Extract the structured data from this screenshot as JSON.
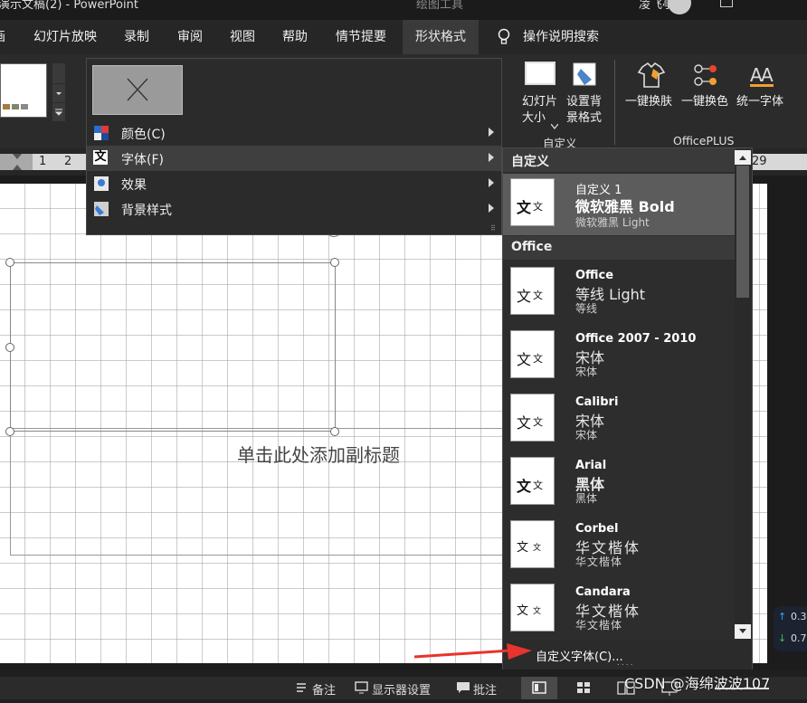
{
  "title_bar": {
    "document_title": "演示文稿(2)  -  PowerPoint",
    "tools_title": "绘图工具",
    "user_name": "凌飞亭"
  },
  "ribbon_tabs": [
    "画",
    "幻灯片放映",
    "录制",
    "审阅",
    "视图",
    "帮助",
    "情节提要",
    "形状格式"
  ],
  "tell_me": "操作说明搜索",
  "ribbon": {
    "slide_size_label_1": "幻灯片",
    "slide_size_label_2": "大小",
    "format_bg_label_1": "设置背",
    "format_bg_label_2": "景格式",
    "customize_group": "自定义",
    "oneclick_skin": "一键换肤",
    "oneclick_color": "一键换色",
    "unify_font": "统一字体",
    "officeplus_group": "OfficePLUS"
  },
  "ruler": {
    "left_ticks": [
      "1",
      "2"
    ],
    "right_tick": "29"
  },
  "theme_menu": {
    "items": [
      {
        "label": "颜色(C)",
        "icon": "colors-icon"
      },
      {
        "label": "字体(F)",
        "icon": "font-wen-icon"
      },
      {
        "label": "效果",
        "icon": "effects-icon"
      },
      {
        "label": "背景样式",
        "icon": "background-style-icon"
      }
    ]
  },
  "slide": {
    "subtitle_placeholder": "单击此处添加副标题"
  },
  "font_gallery": {
    "sections": [
      "自定义",
      "Office"
    ],
    "custom": {
      "name": "自定义 1",
      "heading": "微软雅黑 Bold",
      "body": "微软雅黑 Light"
    },
    "office": [
      {
        "name": "Office",
        "heading": "等线 Light",
        "body": "等线"
      },
      {
        "name": "Office 2007 - 2010",
        "heading": "宋体",
        "body": "宋体"
      },
      {
        "name": "Calibri",
        "heading": "宋体",
        "body": "宋体"
      },
      {
        "name": "Arial",
        "heading": "黑体",
        "body": "黑体"
      },
      {
        "name": "Corbel",
        "heading": "华文楷体",
        "body": "华文楷体"
      },
      {
        "name": "Candara",
        "heading": "华文楷体",
        "body": "华文楷体"
      }
    ],
    "thumb_char_big": "文",
    "thumb_char_small": "文",
    "custom_fonts_link": "自定义字体(C)..."
  },
  "status_bar": {
    "notes": "备注",
    "display_settings": "显示器设置",
    "comments": "批注",
    "watermark": "CSDN @海绵波波107"
  },
  "side_badge": {
    "up": "0.3",
    "down": "0.7"
  },
  "colors": {
    "accent_arrow": "#e8332e",
    "menu_bg": "#2b2b2b",
    "selected_item": "#5c5c5c"
  }
}
